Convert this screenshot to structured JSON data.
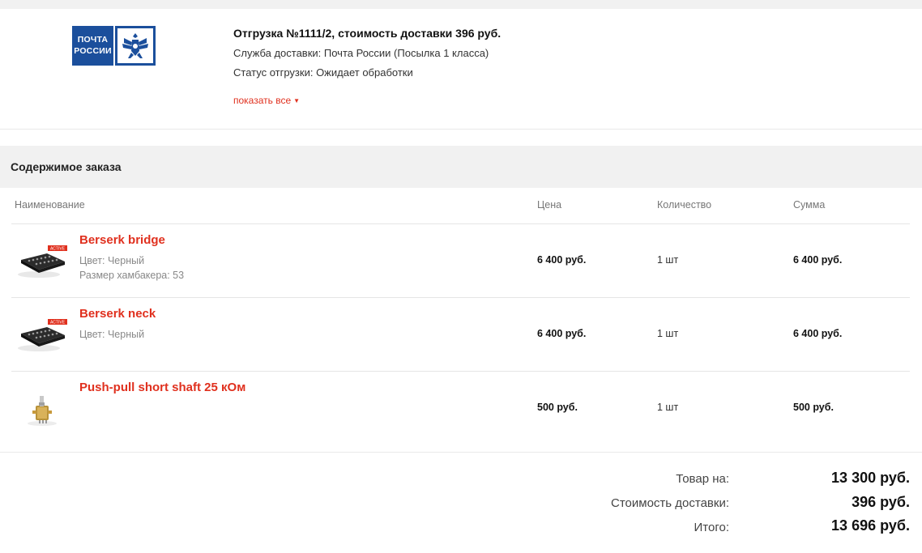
{
  "shipment": {
    "logo_text_line1": "ПОЧТА",
    "logo_text_line2": "РОССИИ",
    "title": "Отгрузка №1111/2, стоимость доставки 396 руб.",
    "service": "Служба доставки: Почта России (Посылка 1 класса)",
    "status": "Статус отгрузки: Ожидает обработки",
    "show_all": "показать все",
    "brand_color": "#1b4f9c"
  },
  "order": {
    "heading": "Содержимое заказа",
    "columns": {
      "name": "Наименование",
      "price": "Цена",
      "qty": "Количество",
      "sum": "Сумма"
    },
    "items": [
      {
        "name": "Berserk bridge",
        "attrs": [
          "Цвет: Черный",
          "Размер хамбакера: 53"
        ],
        "price": "6 400 руб.",
        "qty": "1  шт",
        "sum": "6 400 руб.",
        "image": "humbucker-pickup-icon"
      },
      {
        "name": "Berserk neck",
        "attrs": [
          "Цвет: Черный"
        ],
        "price": "6 400 руб.",
        "qty": "1  шт",
        "sum": "6 400 руб.",
        "image": "humbucker-pickup-icon"
      },
      {
        "name": "Push-pull short shaft 25 кОм",
        "attrs": [],
        "price": "500 руб.",
        "qty": "1  шт",
        "sum": "500 руб.",
        "image": "potentiometer-icon"
      }
    ],
    "badge_text": "ACTIVE"
  },
  "totals": {
    "goods_label": "Товар на:",
    "goods_value": "13 300 руб.",
    "delivery_label": "Стоимость доставки:",
    "delivery_value": "396 руб.",
    "total_label": "Итого:",
    "total_value": "13 696 руб."
  },
  "colors": {
    "accent": "#e0301e",
    "section_bg": "#f1f1f1"
  }
}
